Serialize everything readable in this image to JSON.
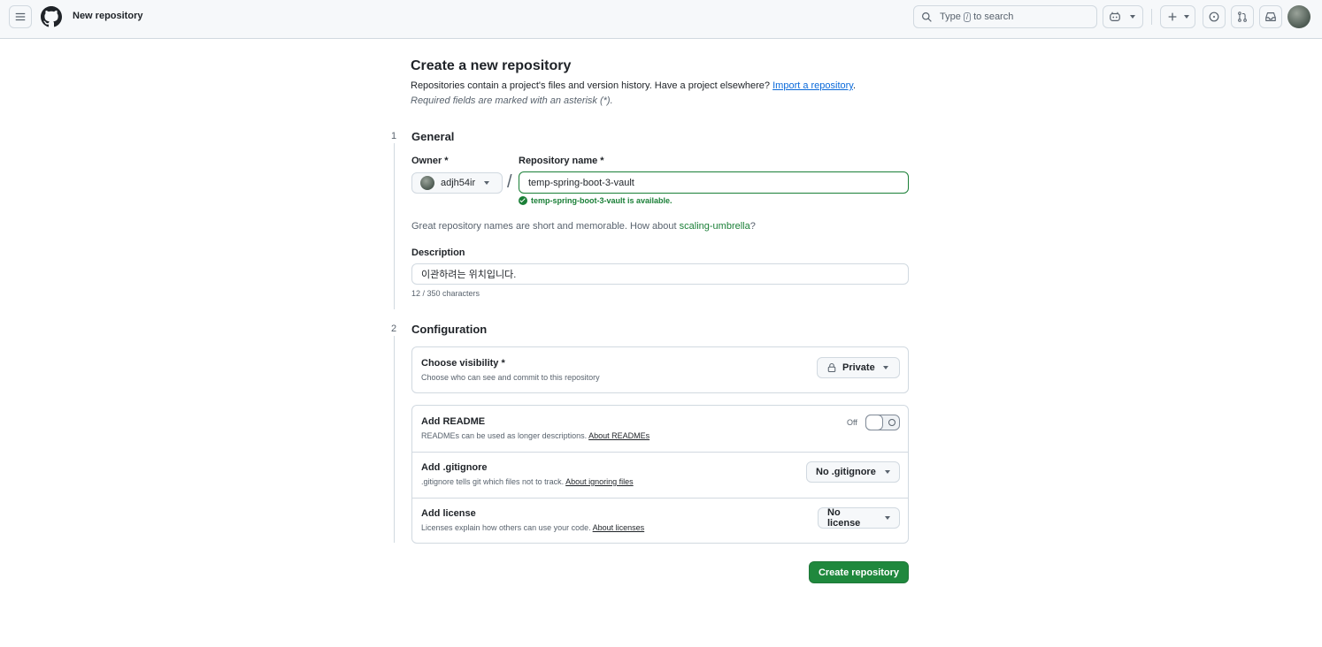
{
  "header": {
    "context": "New repository",
    "search": {
      "prefix": "Type",
      "key": "/",
      "suffix": "to search"
    }
  },
  "page": {
    "title": "Create a new repository",
    "subtitle": "Repositories contain a project's files and version history. Have a project elsewhere?",
    "import_link": "Import a repository",
    "subtitle_end": ".",
    "required_note": "Required fields are marked with an asterisk (*)."
  },
  "general": {
    "step": "1",
    "title": "General",
    "owner_label": "Owner *",
    "owner_value": "adjh54ir",
    "slash": "/",
    "name_label": "Repository name *",
    "name_value": "temp-spring-boot-3-vault",
    "availability": "temp-spring-boot-3-vault is available.",
    "suggest_prefix": "Great repository names are short and memorable. How about",
    "suggest_name": "scaling-umbrella",
    "suggest_suffix": "?",
    "description_label": "Description",
    "description_value": "이관하려는 위치입니다.",
    "char_count": "12 / 350 characters"
  },
  "configuration": {
    "step": "2",
    "title": "Configuration",
    "visibility": {
      "title": "Choose visibility *",
      "desc": "Choose who can see and commit to this repository",
      "value": "Private"
    },
    "readme": {
      "title": "Add README",
      "desc": "READMEs can be used as longer descriptions.",
      "link": "About READMEs",
      "toggle_label": "Off"
    },
    "gitignore": {
      "title": "Add .gitignore",
      "desc": ".gitignore tells git which files not to track.",
      "link": "About ignoring files",
      "value": "No .gitignore"
    },
    "license": {
      "title": "Add license",
      "desc": "Licenses explain how others can use your code.",
      "link": "About licenses",
      "value": "No license"
    }
  },
  "actions": {
    "create": "Create repository"
  },
  "colors": {
    "primary_button": "#1f883d",
    "success": "#1a7f37",
    "link": "#0969da"
  }
}
